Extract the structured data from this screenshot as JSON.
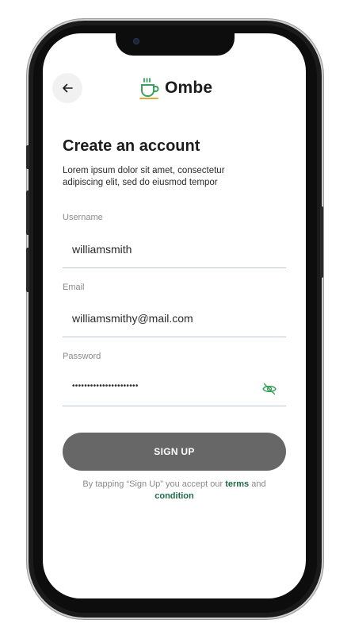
{
  "app": {
    "name": "Ombe"
  },
  "header": {
    "back_icon": "arrow-left-icon",
    "logo_icon": "coffee-cup-icon"
  },
  "page": {
    "title": "Create an account",
    "subtitle": "Lorem ipsum dolor sit amet, consectetur adipiscing elit, sed do eiusmod tempor"
  },
  "form": {
    "username": {
      "label": "Username",
      "value": "williamsmith"
    },
    "email": {
      "label": "Email",
      "value": "williamsmithy@mail.com"
    },
    "password": {
      "label": "Password",
      "value": "••••••••••••••••••••••",
      "toggle_icon": "eye-off-icon"
    }
  },
  "actions": {
    "signup_label": "SIGN UP"
  },
  "terms": {
    "prefix": "By tapping “Sign Up” you accept our ",
    "terms_link": "terms",
    "middle": " and",
    "condition_link": "condition"
  },
  "colors": {
    "accent": "#1e6b45",
    "button": "#676767",
    "logo": "#3aa15b",
    "underline": "#b9c6d6"
  }
}
